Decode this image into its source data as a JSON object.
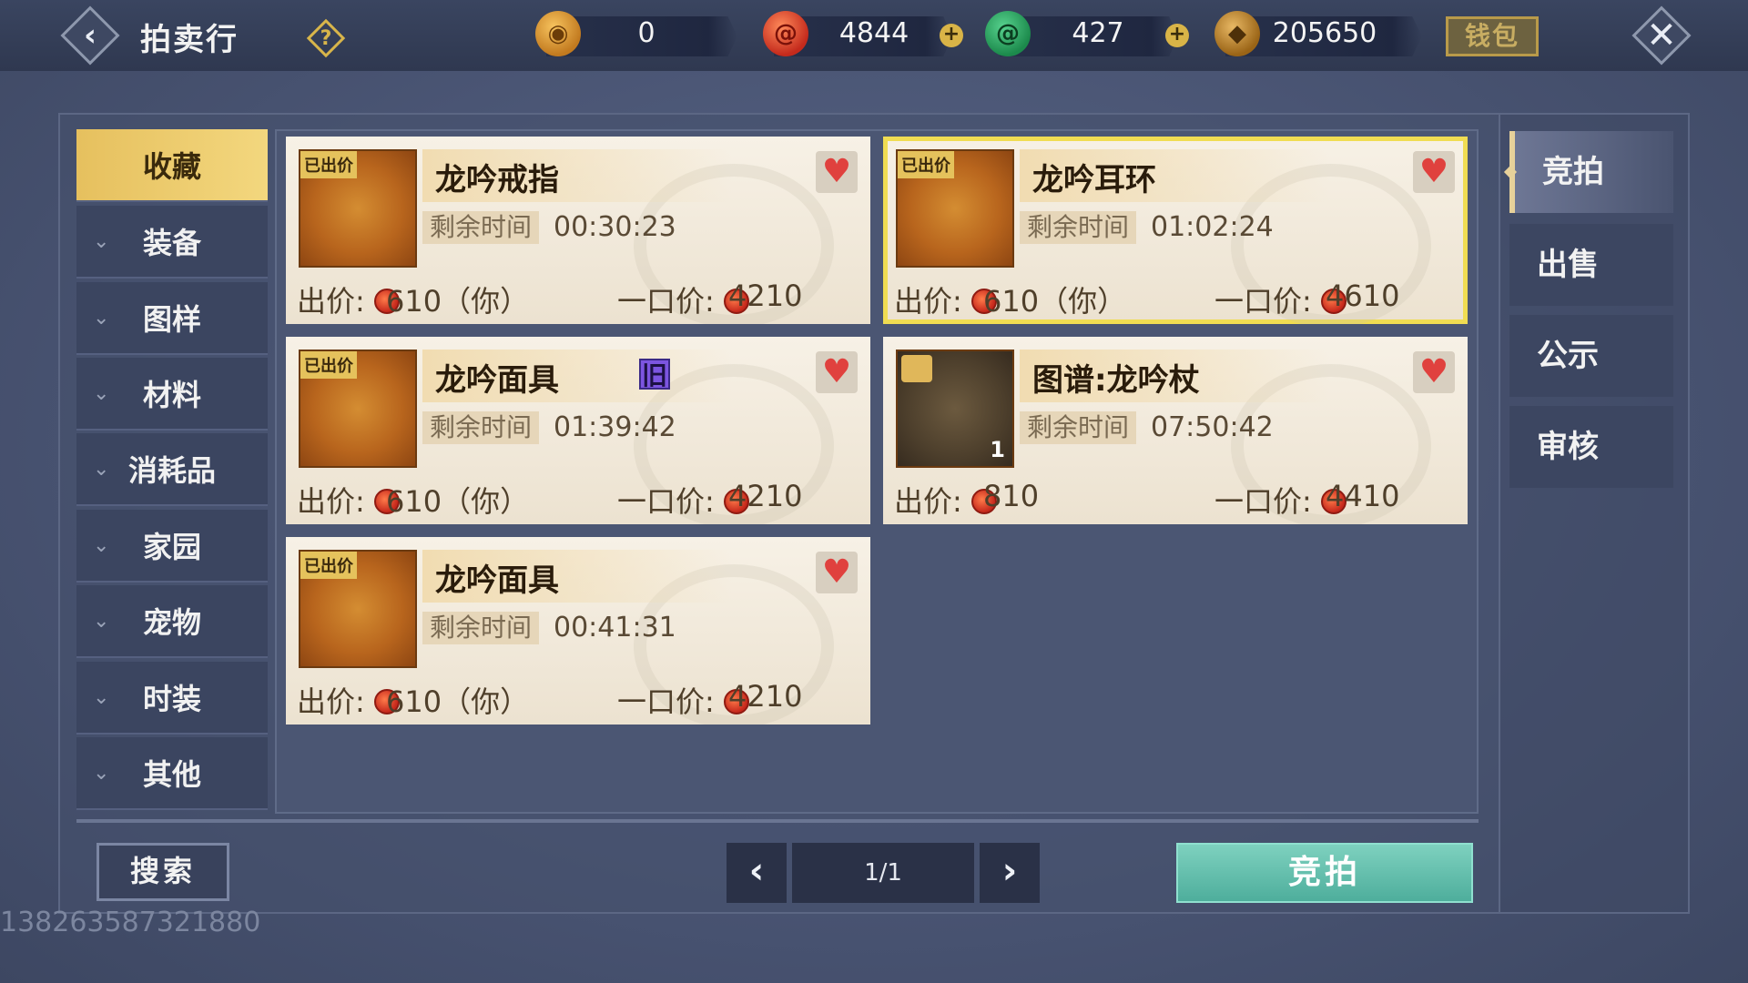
{
  "header": {
    "title": "拍卖行",
    "currencies": [
      {
        "name": "jade-token",
        "value": "0"
      },
      {
        "name": "red-token",
        "value": "4844"
      },
      {
        "name": "green-jade",
        "value": "427"
      },
      {
        "name": "copper-coins",
        "value": "205650"
      }
    ],
    "wallet_label": "钱包"
  },
  "categories": [
    {
      "label": "收藏",
      "active": true
    },
    {
      "label": "装备"
    },
    {
      "label": "图样"
    },
    {
      "label": "材料"
    },
    {
      "label": "消耗品"
    },
    {
      "label": "家园"
    },
    {
      "label": "宠物"
    },
    {
      "label": "时装"
    },
    {
      "label": "其他"
    }
  ],
  "items": [
    {
      "name": "龙吟戒指",
      "tag": "已出价",
      "time_label": "剩余时间",
      "time": "00:30:23",
      "bid_label": "出价:",
      "bid": "610（你）",
      "buy_label": "一口价:",
      "buy": "4210"
    },
    {
      "name": "龙吟耳环",
      "tag": "已出价",
      "time_label": "剩余时间",
      "time": "01:02:24",
      "bid_label": "出价:",
      "bid": "610（你）",
      "buy_label": "一口价:",
      "buy": "4610"
    },
    {
      "name": "龙吟面具",
      "tag": "已出价",
      "badge": "旧",
      "time_label": "剩余时间",
      "time": "01:39:42",
      "bid_label": "出价:",
      "bid": "610（你）",
      "buy_label": "一口价:",
      "buy": "4210"
    },
    {
      "name": "图谱:龙吟杖",
      "quantity": "1",
      "time_label": "剩余时间",
      "time": "07:50:42",
      "bid_label": "出价:",
      "bid": "810",
      "buy_label": "一口价:",
      "buy": "4410"
    },
    {
      "name": "龙吟面具",
      "tag": "已出价",
      "time_label": "剩余时间",
      "time": "00:41:31",
      "bid_label": "出价:",
      "bid": "610（你）",
      "buy_label": "一口价:",
      "buy": "4210"
    }
  ],
  "footer": {
    "search_label": "搜索",
    "page": "1/1",
    "action_label": "竞拍",
    "watermark": "138263587321880"
  },
  "right_tabs": [
    {
      "label": "竞拍",
      "active": true
    },
    {
      "label": "出售"
    },
    {
      "label": "公示"
    },
    {
      "label": "审核"
    }
  ],
  "colors": {
    "accent_gold": "#f3d77e",
    "heart": "#e0413e",
    "action_green": "#4eae9c",
    "selected_outline": "#f0dc52"
  }
}
